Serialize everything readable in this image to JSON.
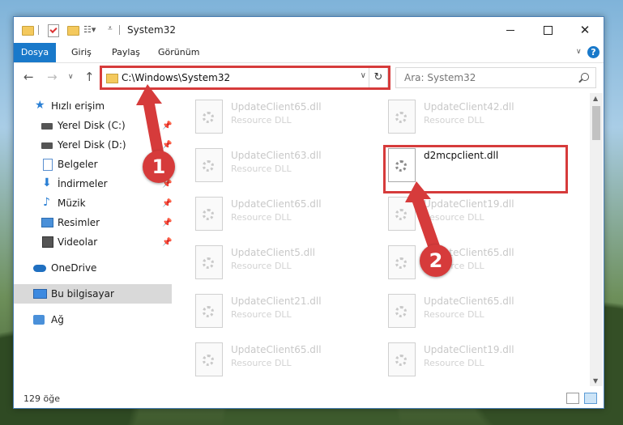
{
  "window": {
    "title": "System32",
    "controls": {
      "minimize": "",
      "maximize": "",
      "close": "✕"
    }
  },
  "ribbon": {
    "tabs": [
      "Dosya",
      "Giriş",
      "Paylaş",
      "Görünüm"
    ],
    "help": "?"
  },
  "address_bar": {
    "path": "C:\\Windows\\System32",
    "refresh_icon": "↻"
  },
  "search": {
    "placeholder": "Ara: System32"
  },
  "sidebar": {
    "items": [
      {
        "label": "Hızlı erişim",
        "icon": "star-icon"
      },
      {
        "label": "Yerel Disk (C:)",
        "icon": "drive-icon",
        "pinned": true
      },
      {
        "label": "Yerel Disk (D:)",
        "icon": "drive-icon",
        "pinned": true
      },
      {
        "label": "Belgeler",
        "icon": "document-icon",
        "pinned": true
      },
      {
        "label": "İndirmeler",
        "icon": "download-icon",
        "pinned": true
      },
      {
        "label": "Müzik",
        "icon": "music-icon",
        "pinned": true
      },
      {
        "label": "Resimler",
        "icon": "pictures-icon",
        "pinned": true
      },
      {
        "label": "Videolar",
        "icon": "video-icon",
        "pinned": true
      },
      {
        "label": "OneDrive",
        "icon": "cloud-icon"
      },
      {
        "label": "Bu bilgisayar",
        "icon": "computer-icon",
        "selected": true
      },
      {
        "label": "Ağ",
        "icon": "network-icon"
      }
    ]
  },
  "files": [
    {
      "name": "UpdateClient65.dll",
      "type": "Resource DLL"
    },
    {
      "name": "UpdateClient42.dll",
      "type": "Resource DLL"
    },
    {
      "name": "UpdateClient63.dll",
      "type": "Resource DLL"
    },
    {
      "name": "d2mcpclient.dll",
      "type": "",
      "active": true
    },
    {
      "name": "UpdateClient65.dll",
      "type": "Resource DLL"
    },
    {
      "name": "UpdateClient19.dll",
      "type": "Resource DLL"
    },
    {
      "name": "UpdateClient5.dll",
      "type": "Resource DLL"
    },
    {
      "name": "UpdateClient65.dll",
      "type": "Resource DLL"
    },
    {
      "name": "UpdateClient21.dll",
      "type": "Resource DLL"
    },
    {
      "name": "UpdateClient65.dll",
      "type": "Resource DLL"
    },
    {
      "name": "UpdateClient65.dll",
      "type": "Resource DLL"
    },
    {
      "name": "UpdateClient19.dll",
      "type": "Resource DLL"
    }
  ],
  "status": {
    "item_count": "129 öğe"
  },
  "annotations": {
    "badge1": "1",
    "badge2": "2",
    "color": "#d63b3b"
  }
}
